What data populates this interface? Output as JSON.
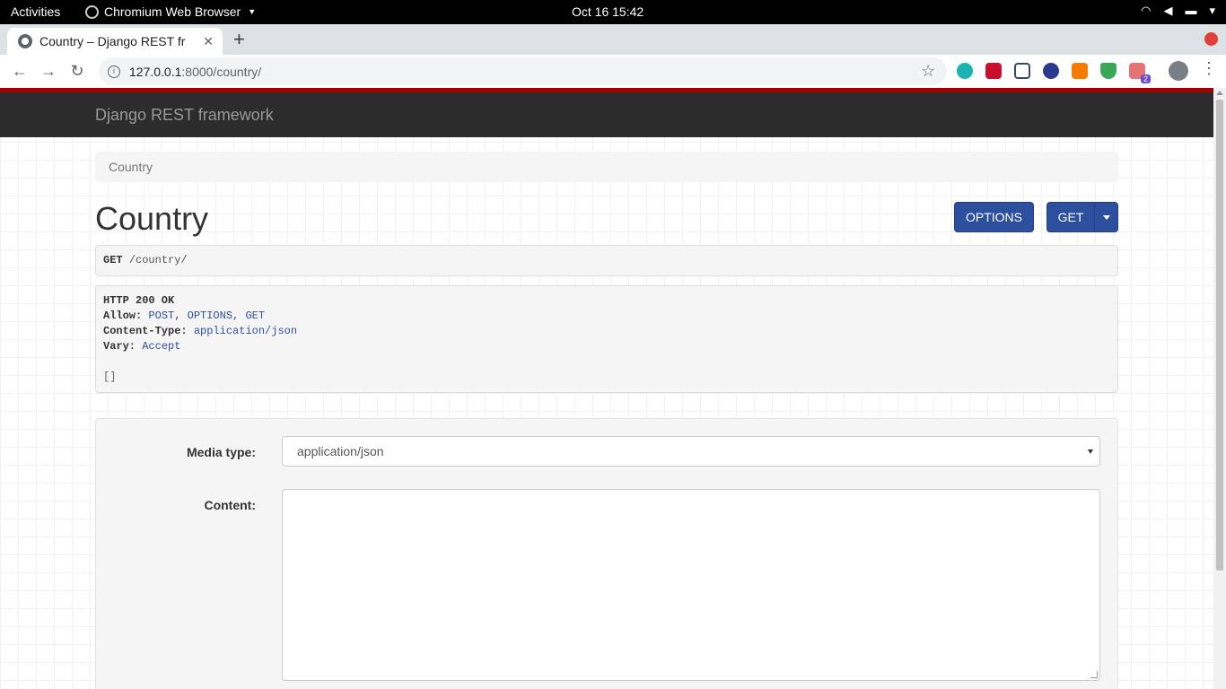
{
  "system_bar": {
    "activities": "Activities",
    "app_name": "Chromium Web Browser",
    "clock": "Oct 16  15:42"
  },
  "browser": {
    "tab_title": "Country – Django REST fr",
    "url_host": "127.0.0.1",
    "url_path": ":8000/country/",
    "extension_badge": "2"
  },
  "navbar": {
    "brand": "Django REST framework"
  },
  "breadcrumb": {
    "item": "Country"
  },
  "header": {
    "title": "Country",
    "options_label": "OPTIONS",
    "get_label": "GET"
  },
  "request": {
    "method": "GET",
    "path": "/country/"
  },
  "response": {
    "status": "HTTP 200 OK",
    "headers": [
      {
        "name": "Allow:",
        "value": "POST, OPTIONS, GET"
      },
      {
        "name": "Content-Type:",
        "value": "application/json"
      },
      {
        "name": "Vary:",
        "value": "Accept"
      }
    ],
    "body": "[]"
  },
  "form": {
    "media_type_label": "Media type:",
    "media_type_value": "application/json",
    "content_label": "Content:",
    "content_value": ""
  },
  "colors": {
    "navbar": "#2c2c2c",
    "accent_bar": "#a30000",
    "button": "#2c4f9e"
  }
}
